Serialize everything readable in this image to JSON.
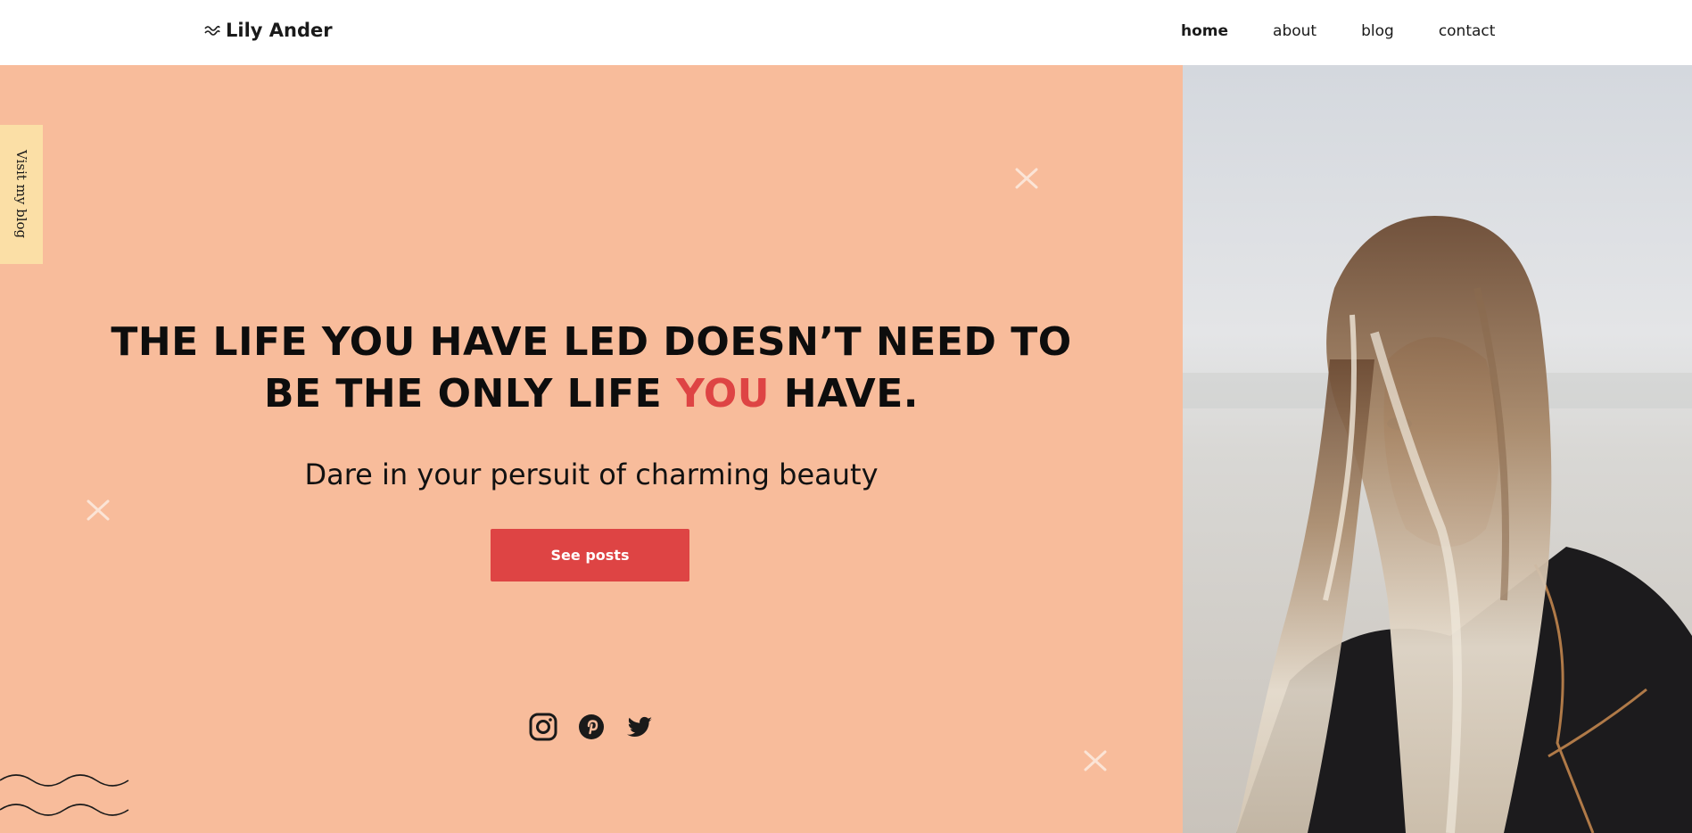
{
  "header": {
    "brand": "Lily Ander",
    "nav": [
      {
        "label": "home",
        "active": true
      },
      {
        "label": "about",
        "active": false
      },
      {
        "label": "blog",
        "active": false
      },
      {
        "label": "contact",
        "active": false
      }
    ]
  },
  "side_tab": {
    "label": "Visit my blog"
  },
  "hero": {
    "headline_line1": "THE LIFE YOU HAVE LED DOESN’T NEED TO",
    "headline_line2_before": "BE THE ONLY LIFE ",
    "headline_accent": "YOU",
    "headline_line2_after": " HAVE.",
    "subtitle": "Dare in your persuit of charming beauty",
    "cta_label": "See posts"
  },
  "socials": [
    "instagram-icon",
    "pinterest-icon",
    "twitter-icon"
  ],
  "colors": {
    "hero_bg": "#f8bc9b",
    "accent": "#de4444",
    "side_tab_bg": "#fbdfa6",
    "text": "#0d0d0d"
  }
}
